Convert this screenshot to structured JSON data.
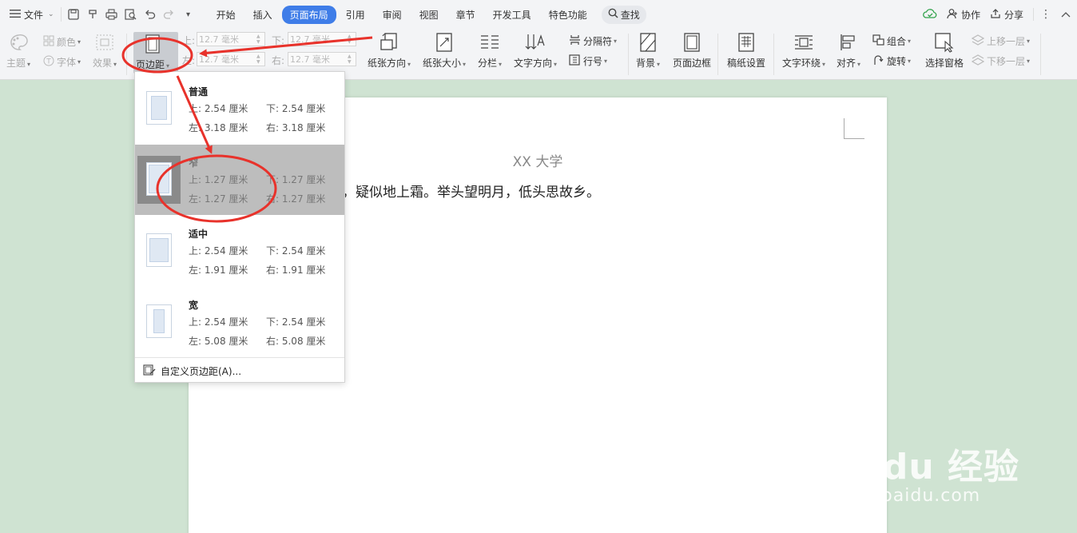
{
  "topbar": {
    "file_label": "文件",
    "tabs": [
      {
        "label": "开始"
      },
      {
        "label": "插入"
      },
      {
        "label": "页面布局"
      },
      {
        "label": "引用"
      },
      {
        "label": "审阅"
      },
      {
        "label": "视图"
      },
      {
        "label": "章节"
      },
      {
        "label": "开发工具"
      },
      {
        "label": "特色功能"
      }
    ],
    "search_label": "查找",
    "collab_label": "协作",
    "share_label": "分享"
  },
  "ribbon": {
    "theme_label": "主题",
    "color_label": "颜色",
    "font_label": "字体",
    "effect_label": "效果",
    "margin_label": "页边距",
    "top_label": "上:",
    "bottom_label": "下:",
    "left_label": "左:",
    "right_label": "右:",
    "top_value": "12.7 毫米",
    "bottom_value": "12.7 毫米",
    "left_value": "12.7 毫米",
    "right_value": "12.7 毫米",
    "orientation_label": "纸张方向",
    "size_label": "纸张大小",
    "columns_label": "分栏",
    "text_direction_label": "文字方向",
    "separator_label": "分隔符",
    "line_number_label": "行号",
    "background_label": "背景",
    "page_border_label": "页面边框",
    "manuscript_label": "稿纸设置",
    "wrap_label": "文字环绕",
    "align_label": "对齐",
    "group_label": "组合",
    "rotate_label": "旋转",
    "selection_pane_label": "选择窗格",
    "bring_forward_label": "上移一层",
    "send_backward_label": "下移一层"
  },
  "document": {
    "title": "XX 大学",
    "body": "，疑似地上霜。举头望明月，低头思故乡。"
  },
  "margin_menu": {
    "options": [
      {
        "name": "普通",
        "top": "上: 2.54 厘米",
        "bottom": "下: 2.54 厘米",
        "left": "左: 3.18 厘米",
        "right": "右: 3.18 厘米"
      },
      {
        "name": "窄",
        "top": "上: 1.27 厘米",
        "bottom": "下: 1.27 厘米",
        "left": "左: 1.27 厘米",
        "right": "右: 1.27 厘米"
      },
      {
        "name": "适中",
        "top": "上: 2.54 厘米",
        "bottom": "下: 2.54 厘米",
        "left": "左: 1.91 厘米",
        "right": "右: 1.91 厘米"
      },
      {
        "name": "宽",
        "top": "上: 2.54 厘米",
        "bottom": "下: 2.54 厘米",
        "left": "左: 5.08 厘米",
        "right": "右: 5.08 厘米"
      }
    ],
    "selected_index": 1,
    "custom_label": "自定义页边距(A)..."
  },
  "watermark": {
    "brand": "Bai du 经验",
    "url": "jingyan.baidu.com"
  },
  "colors": {
    "accent": "#3f7de8",
    "annotation": "#e8322b",
    "workspace": "#cfe3d2"
  }
}
